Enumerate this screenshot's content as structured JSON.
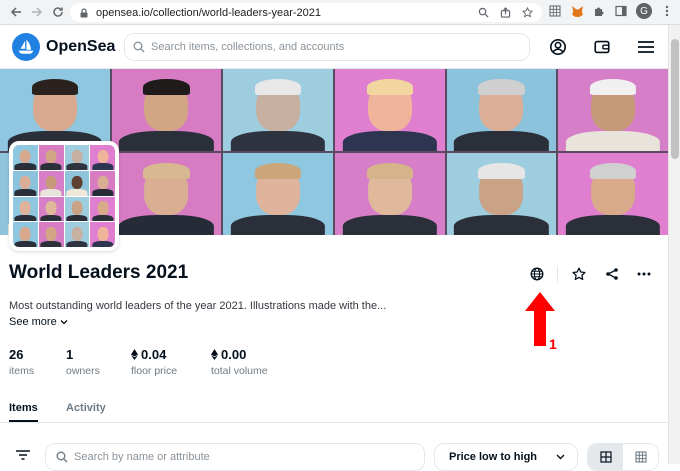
{
  "browser": {
    "url": "opensea.io/collection/world-leaders-year-2021"
  },
  "site": {
    "logo_text": "OpenSea",
    "search_placeholder": "Search items, collections, and accounts"
  },
  "banner": {
    "tiles": [
      {
        "bg": "#8fc6e0",
        "head": "#d8a98f",
        "hair": "#2b2220",
        "body": "#2a2f3a"
      },
      {
        "bg": "#d77bc3",
        "head": "#d2a584",
        "hair": "#1f1b1b",
        "body": "#2a2f3a"
      },
      {
        "bg": "#9fcde0",
        "head": "#c8b0a0",
        "hair": "#e8e8e8",
        "body": "#2e3340"
      },
      {
        "bg": "#e07fcf",
        "head": "#f0b49a",
        "hair": "#f2d6a0",
        "body": "#2d3550"
      },
      {
        "bg": "#8cc3dc",
        "head": "#dcae98",
        "hair": "#cfcfcf",
        "body": "#2a2f3a"
      },
      {
        "bg": "#d67fc8",
        "head": "#c69a78",
        "hair": "#f0f0f0",
        "body": "#e8e4dc"
      },
      {
        "bg": "#8ec4dc",
        "head": "#5e4030",
        "hair": "#eaeaea",
        "body": "#efe8d8"
      },
      {
        "bg": "#d77bc3",
        "head": "#d9ae92",
        "hair": "#d8b890",
        "body": "#262b38"
      },
      {
        "bg": "#8fc6e0",
        "head": "#e0b49c",
        "hair": "#caa67a",
        "body": "#2a2f3a"
      },
      {
        "bg": "#d67fc8",
        "head": "#e0b89c",
        "hair": "#d6b48a",
        "body": "#2a2f3a"
      },
      {
        "bg": "#9fcde0",
        "head": "#caa386",
        "hair": "#e6e6e6",
        "body": "#2a2f3a"
      },
      {
        "bg": "#e07fcf",
        "head": "#d8aa8a",
        "hair": "#d0d0d0",
        "body": "#2a2f3a"
      }
    ]
  },
  "collection": {
    "title": "World Leaders 2021",
    "description": "Most outstanding world leaders of the year 2021. Illustrations made with the...",
    "see_more": "See more"
  },
  "stats": [
    {
      "value": "26",
      "label": "items",
      "eth": false
    },
    {
      "value": "1",
      "label": "owners",
      "eth": false
    },
    {
      "value": "0.04",
      "label": "floor price",
      "eth": true
    },
    {
      "value": "0.00",
      "label": "total volume",
      "eth": true
    }
  ],
  "annotation": {
    "number": "1",
    "color": "#ff0000"
  },
  "tabs": [
    {
      "label": "Items",
      "active": true
    },
    {
      "label": "Activity",
      "active": false
    }
  ],
  "filters": {
    "search_placeholder": "Search by name or attribute",
    "sort_label": "Price low to high"
  },
  "colors": {
    "brand": "#2081e2",
    "text": "#04111d",
    "muted": "#707a83"
  }
}
